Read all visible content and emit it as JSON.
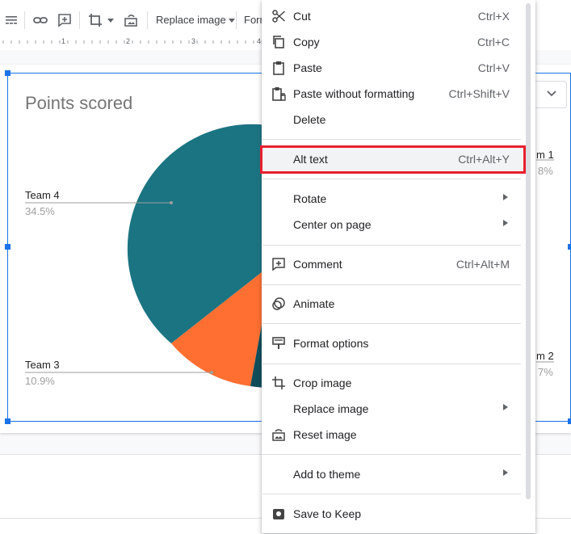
{
  "toolbar": {
    "replace_image_label": "Replace image",
    "format_label_partial": "Form"
  },
  "ruler": {
    "numbers": [
      "1",
      "2",
      "3",
      "4"
    ]
  },
  "slide": {
    "chart_title": "Points scored",
    "labels": {
      "team4": {
        "name": "Team 4",
        "pct": "34.5%"
      },
      "team3": {
        "name": "Team 3",
        "pct": "10.9%"
      },
      "team1": {
        "name": "m 1",
        "pct": "8%"
      },
      "team2": {
        "name": "m 2",
        "pct": "7%"
      }
    }
  },
  "colors": {
    "teal": "#1b7482",
    "orange": "#ff6f31",
    "dark_teal": "#0f4d5a",
    "selection_blue": "#1a73e8",
    "highlight_red": "#e8202d"
  },
  "context_menu": {
    "items": [
      {
        "label": "Cut",
        "shortcut": "Ctrl+X",
        "icon": "scissors-icon"
      },
      {
        "label": "Copy",
        "shortcut": "Ctrl+C",
        "icon": "copy-icon"
      },
      {
        "label": "Paste",
        "shortcut": "Ctrl+V",
        "icon": "clipboard-icon"
      },
      {
        "label": "Paste without formatting",
        "shortcut": "Ctrl+Shift+V",
        "icon": "paste-plain-icon"
      },
      {
        "label": "Delete",
        "shortcut": "",
        "icon": ""
      },
      {
        "label": "Alt text",
        "shortcut": "Ctrl+Alt+Y",
        "icon": ""
      },
      {
        "label": "Rotate",
        "shortcut": "",
        "icon": ""
      },
      {
        "label": "Center on page",
        "shortcut": "",
        "icon": ""
      },
      {
        "label": "Comment",
        "shortcut": "Ctrl+Alt+M",
        "icon": "add-comment-icon"
      },
      {
        "label": "Animate",
        "shortcut": "",
        "icon": "animate-icon"
      },
      {
        "label": "Format options",
        "shortcut": "",
        "icon": "format-options-icon"
      },
      {
        "label": "Crop image",
        "shortcut": "",
        "icon": "crop-icon"
      },
      {
        "label": "Replace image",
        "shortcut": "",
        "icon": ""
      },
      {
        "label": "Reset image",
        "shortcut": "",
        "icon": "reset-image-icon"
      },
      {
        "label": "Add to theme",
        "shortcut": "",
        "icon": ""
      },
      {
        "label": "Save to Keep",
        "shortcut": "",
        "icon": "keep-icon"
      }
    ]
  }
}
